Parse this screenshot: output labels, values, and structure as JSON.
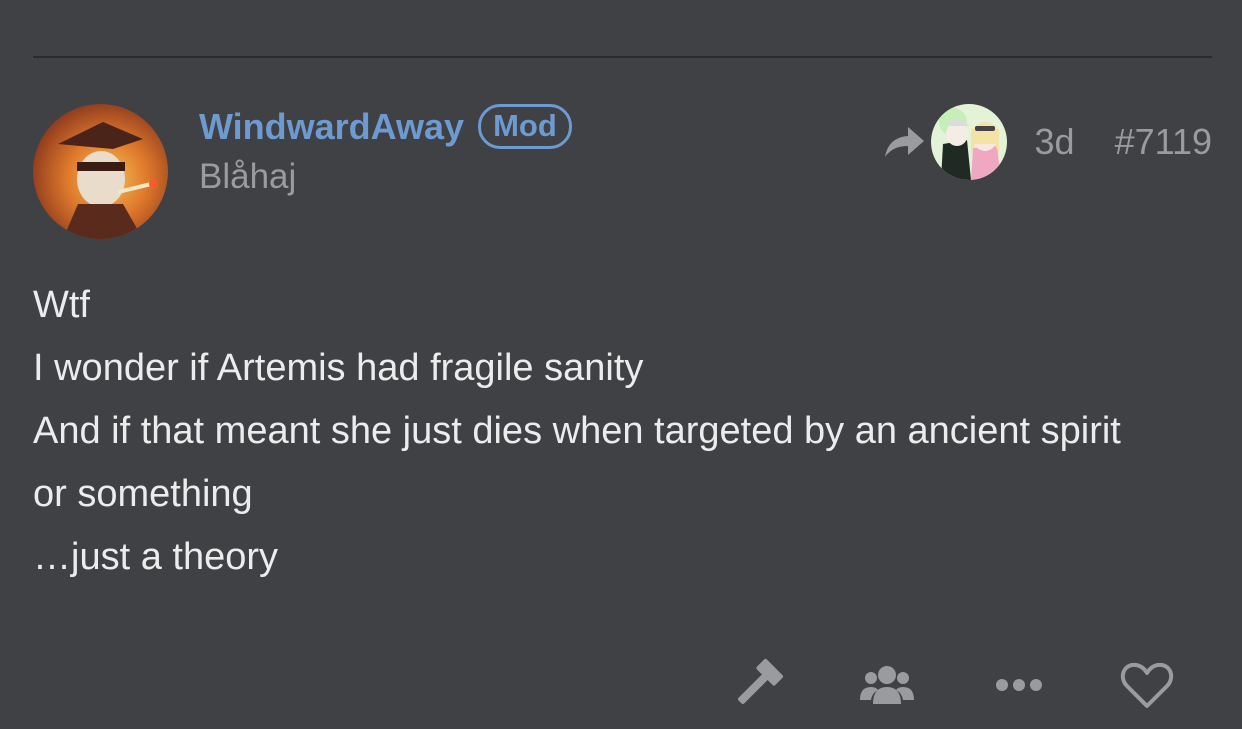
{
  "post": {
    "author": {
      "name": "WindwardAway",
      "badge": "Mod",
      "subtitle": "Blåhaj"
    },
    "meta": {
      "time": "3d",
      "post_number": "#7119"
    },
    "body": [
      "Wtf",
      "I wonder if Artemis had fragile sanity",
      "And if that meant she just dies when targeted by an ancient spirit or something",
      "…just a theory"
    ],
    "actions": [
      {
        "icon": "gavel-icon"
      },
      {
        "icon": "users-icon"
      },
      {
        "icon": "more-icon"
      },
      {
        "icon": "heart-icon"
      }
    ]
  },
  "colors": {
    "background": "#3f4145",
    "accent": "#6d9ad0",
    "muted": "#9a9b9e",
    "text": "#ececec"
  }
}
